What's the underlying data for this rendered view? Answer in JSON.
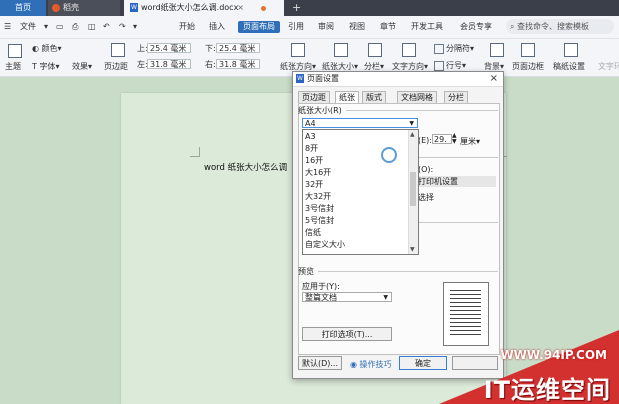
{
  "tabs": {
    "home": "首页",
    "daoke": "稻壳",
    "doc": "word纸张大小怎么调.docx",
    "close": "×",
    "plus": "+"
  },
  "menu": {
    "file": "文件",
    "items": [
      "开始",
      "插入",
      "页面布局",
      "引用",
      "审阅",
      "视图",
      "章节",
      "开发工具",
      "会员专享"
    ],
    "search_label": "查找命令、搜索模板"
  },
  "ribbon": {
    "color": "颜色",
    "theme": "主题",
    "font": "字体",
    "effect": "效果",
    "margins": "页边距",
    "top_label": "上:",
    "top_value": "25.4 毫米",
    "bottom_label": "下:",
    "bottom_value": "25.4 毫米",
    "left_label": "左:",
    "left_value": "31.8 毫米",
    "right_label": "右:",
    "right_value": "31.8 毫米",
    "orientation": "纸张方向",
    "size": "纸张大小",
    "columns": "分栏",
    "text_direction": "文字方向",
    "line_number": "行号",
    "separator": "分隔符",
    "background": "背景",
    "page_border": "页面边框",
    "manuscript": "稿纸设置",
    "wrap": "文字环"
  },
  "document": {
    "body_text": "word 纸张大小怎么调"
  },
  "dialog": {
    "title": "页面设置",
    "close": "×",
    "tabs": [
      "页边距",
      "纸张",
      "版式",
      "文档网格",
      "分栏"
    ],
    "paper_size_label": "纸张大小(R)",
    "paper_size_value": "A4",
    "paper_options": [
      "A3",
      "8开",
      "16开",
      "大16开",
      "32开",
      "大32开",
      "3号信封",
      "5号信封",
      "信纸",
      "自定义大小"
    ],
    "height_label": "(E):",
    "height_value": "29.",
    "height_unit": "厘米",
    "source_label": "(O):",
    "printer_setting": "打印机设置",
    "select_text": "选择",
    "preview_label": "预览",
    "apply_label": "应用于(Y):",
    "apply_value": "整篇文档",
    "print_options_button": "打印选项(T)...",
    "default_button": "默认(D)...",
    "tips": "操作技巧",
    "ok_button": "确定"
  },
  "watermark": {
    "url": "WWW.94IP.COM",
    "brand": "IT运维空间"
  }
}
